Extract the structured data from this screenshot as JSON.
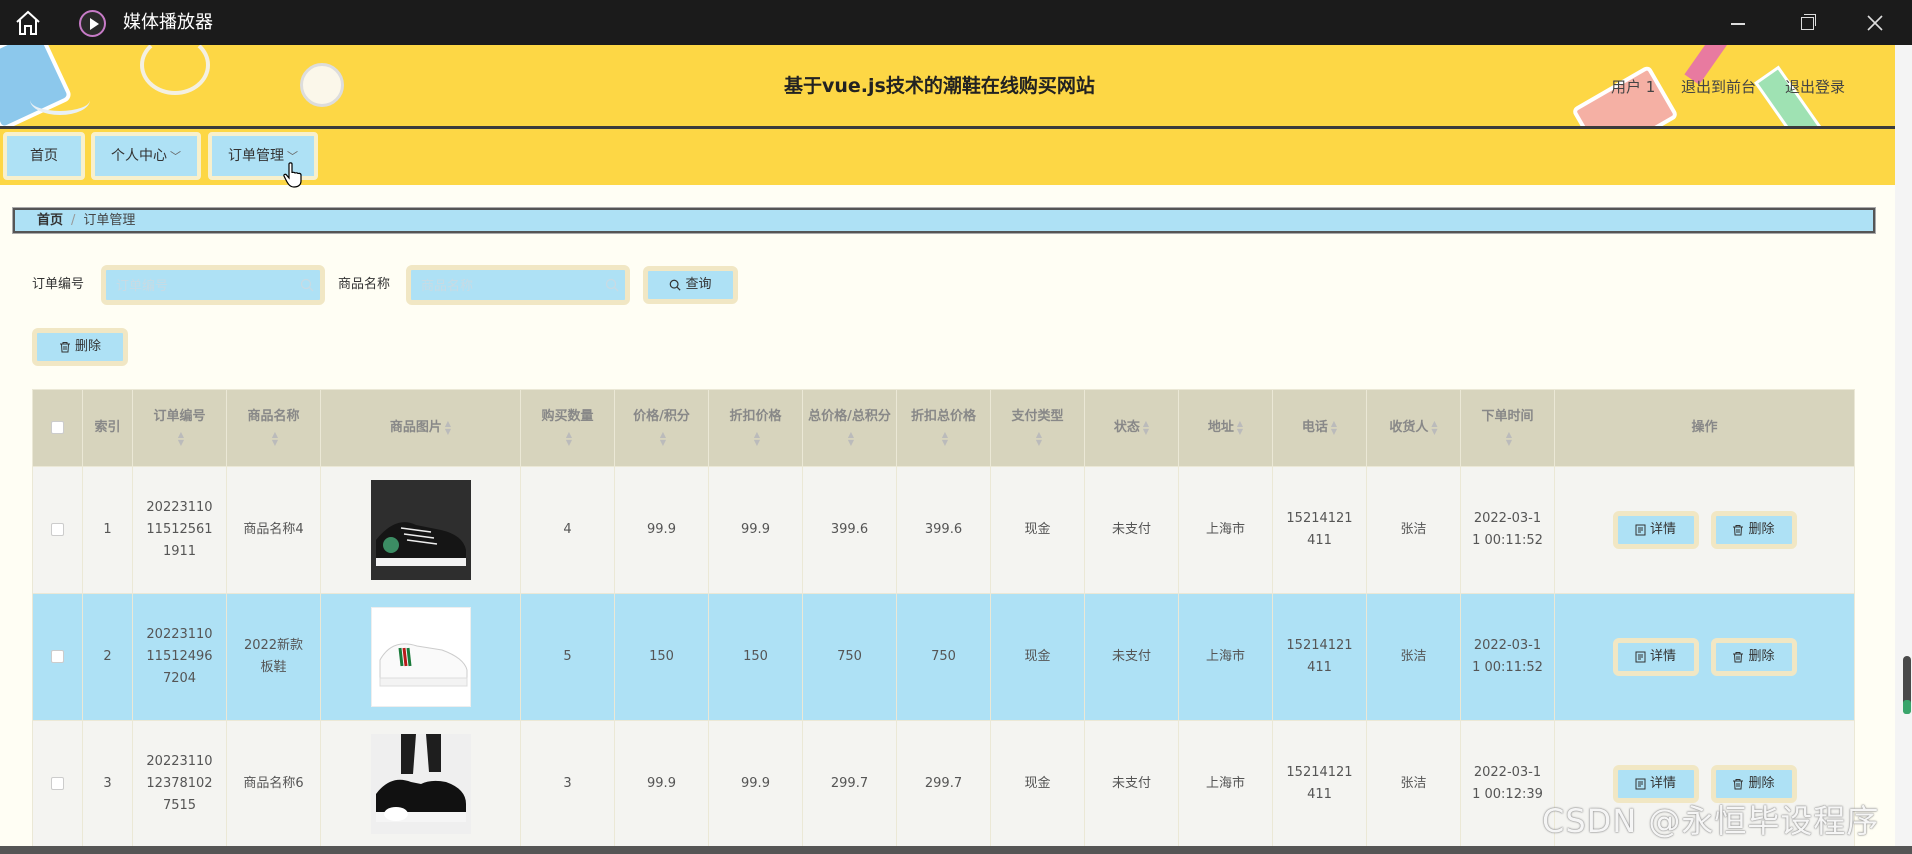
{
  "window": {
    "title": "媒体播放器"
  },
  "header": {
    "site_title": "基于vue.js技术的潮鞋在线购买网站",
    "user": "用户 1",
    "back_front": "退出到前台",
    "logout": "退出登录"
  },
  "nav": {
    "home": "首页",
    "personal": "个人中心",
    "orders": "订单管理"
  },
  "breadcrumb": {
    "home": "首页",
    "separator": "/",
    "current": "订单管理"
  },
  "search": {
    "order_no_label": "订单编号",
    "order_no_placeholder": "订单编号",
    "product_label": "商品名称",
    "product_placeholder": "商品名称",
    "query_button": "查询",
    "delete_button": "删除"
  },
  "table": {
    "columns": [
      "索引",
      "订单编号",
      "商品名称",
      "商品图片",
      "购买数量",
      "价格/积分",
      "折扣价格",
      "总价格/总积分",
      "折扣总价格",
      "支付类型",
      "状态",
      "地址",
      "电话",
      "收货人",
      "下单时间",
      "操作"
    ],
    "rows": [
      {
        "index": "1",
        "order_no": "202231101151256119 11",
        "order_no_display": "20223110\n11512561\n1911",
        "product": "商品名称4",
        "qty": "4",
        "price": "99.9",
        "discount_price": "99.9",
        "total": "399.6",
        "discount_total": "399.6",
        "pay_type": "现金",
        "status": "未支付",
        "address": "上海市",
        "phone": "15214121\n411",
        "receiver": "张洁",
        "time": "2022-03-1\n1 00:11:52"
      },
      {
        "index": "2",
        "order_no_display": "20223110\n11512496\n7204",
        "product": "2022新款\n板鞋",
        "qty": "5",
        "price": "150",
        "discount_price": "150",
        "total": "750",
        "discount_total": "750",
        "pay_type": "现金",
        "status": "未支付",
        "address": "上海市",
        "phone": "15214121\n411",
        "receiver": "张洁",
        "time": "2022-03-1\n1 00:11:52"
      },
      {
        "index": "3",
        "order_no_display": "20223110\n12378102\n7515",
        "product": "商品名称6",
        "qty": "3",
        "price": "99.9",
        "discount_price": "99.9",
        "total": "299.7",
        "discount_total": "299.7",
        "pay_type": "现金",
        "status": "未支付",
        "address": "上海市",
        "phone": "15214121\n411",
        "receiver": "张洁",
        "time": "2022-03-1\n1 00:12:39"
      }
    ],
    "detail_button": "详情",
    "delete_button": "删除"
  },
  "watermark": "CSDN @永恒毕设程序",
  "colors": {
    "header_bg": "#fdd745",
    "button_bg": "#aee1f5",
    "button_border": "#f1e7c4",
    "table_header_bg": "#d7d4bd",
    "highlight_row": "#aee1f5",
    "page_bg": "#fffef4"
  }
}
